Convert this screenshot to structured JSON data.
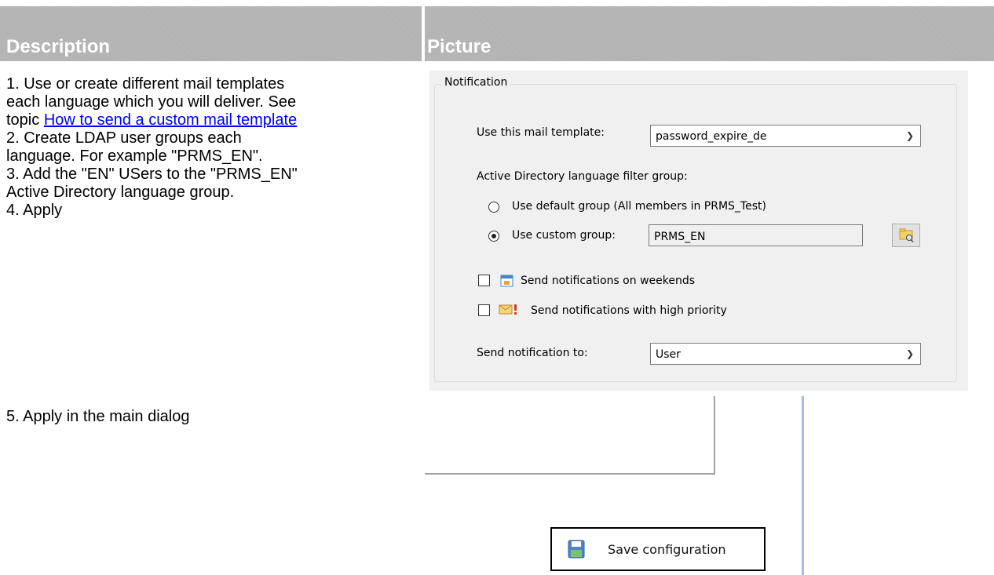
{
  "headers": {
    "description": "Description",
    "picture": "Picture"
  },
  "steps": {
    "s1a": "1. Use or create different mail templates",
    "s1b": "each language which you will deliver. See",
    "s1c_prefix": "topic ",
    "s1c_link": "How to send a custom mail template",
    "s2a": "2. Create LDAP user groups each",
    "s2b": "language. For example \"PRMS_EN\".",
    "s3a": "3. Add the \"EN\" USers to the \"PRMS_EN\"",
    "s3b": "Active Directory language group.",
    "s4": "4. Apply",
    "s5": "5. Apply in the main dialog"
  },
  "dialog": {
    "group_title": "Notification",
    "template_label": "Use this mail template:",
    "template_value": "password_expire_de",
    "filter_label": "Active Directory language filter group:",
    "radio_default": "Use default group (All members in PRMS_Test)",
    "radio_custom": "Use custom group:",
    "custom_group_value": "PRMS_EN",
    "weekend_label": "Send notifications on weekends",
    "priority_label": "Send notifications with high priority",
    "send_to_label": "Send notification to:",
    "send_to_value": "User"
  },
  "fragment": {
    "save_label": "Save configuration"
  },
  "icons": {
    "dropdown": "chevron-down-icon",
    "browse": "folder-search-icon",
    "calendar": "calendar-icon",
    "mail_priority": "mail-priority-icon",
    "save": "floppy-disk-icon"
  }
}
